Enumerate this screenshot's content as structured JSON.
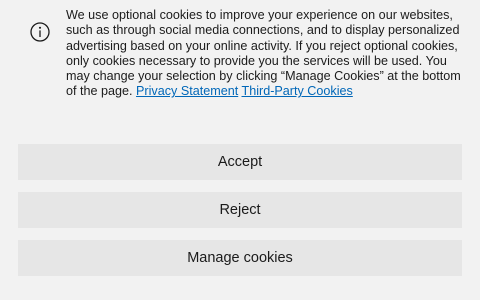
{
  "notice": {
    "icon": "info-icon",
    "text": "We use optional cookies to improve your experience on our websites, such as through social media connections, and to display personalized advertising based on your online activity. If you reject optional cookies, only cookies necessary to provide you the services will be used. You may change your selection by clicking “Manage Cookies” at the bottom of the page.",
    "privacy_link": "Privacy Statement",
    "third_party_link": "Third-Party Cookies"
  },
  "buttons": {
    "accept_label": "Accept",
    "reject_label": "Reject",
    "manage_label": "Manage cookies"
  },
  "colors": {
    "background": "#f2f2f2",
    "button_bg": "#e6e6e6",
    "link": "#0067b8",
    "text": "#1b1b1b"
  }
}
